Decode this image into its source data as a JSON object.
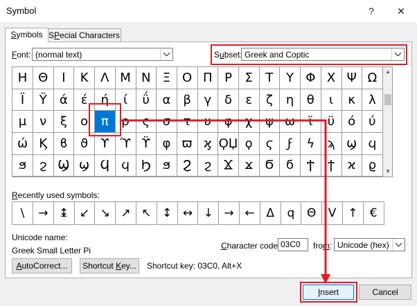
{
  "window": {
    "title": "Symbol",
    "help_glyph": "?",
    "close_glyph": "✕"
  },
  "tabs": [
    {
      "label_key": "S",
      "label_rest": "ymbols"
    },
    {
      "label_key": "P",
      "label_pre": "S",
      "label_rest": "ecial Characters"
    }
  ],
  "font": {
    "label_key": "F",
    "label_rest": "ont:",
    "value": "(normal text)"
  },
  "subset": {
    "label_pre": "S",
    "label_key": "u",
    "label_rest": "bset:",
    "value": "Greek and Coptic"
  },
  "grid": {
    "rows": [
      [
        "Η",
        "Θ",
        "Ι",
        "Κ",
        "Λ",
        "Μ",
        "Ν",
        "Ξ",
        "Ο",
        "Π",
        "Ρ",
        "Σ",
        "Τ",
        "Υ",
        "Φ",
        "Χ",
        "Ψ",
        "Ω"
      ],
      [
        "Ϊ",
        "Ϋ",
        "ά",
        "έ",
        "ή",
        "ί",
        "ΰ",
        "α",
        "β",
        "γ",
        "δ",
        "ε",
        "ζ",
        "η",
        "θ",
        "ι",
        "κ",
        "λ"
      ],
      [
        "μ",
        "ν",
        "ξ",
        "ο",
        "π",
        "ρ",
        "ς",
        "σ",
        "τ",
        "υ",
        "φ",
        "χ",
        "ψ",
        "ω",
        "ϊ",
        "ϋ",
        "ό",
        "ύ"
      ],
      [
        "ώ",
        "Ϗ",
        "ϐ",
        "ϑ",
        "ϒ",
        "ϓ",
        "ϔ",
        "φ",
        "ϖ",
        "ϗ",
        "ϘЏ",
        "ϙ",
        "ϛ",
        "ϝ",
        "ϟ",
        "ϡ",
        "ϣ",
        "ϥ"
      ],
      [
        "ϧ",
        "ϩ",
        "Ϣ",
        "ϣ",
        "Ϥ",
        "ϥ",
        "Ϧ",
        "ϧ",
        "Ϩ",
        "ϩ",
        "Ϫ",
        "ϫ",
        "Ϭ",
        "ϭ",
        "Ϯ",
        "ϯ",
        "ϰ",
        "ϱ"
      ]
    ],
    "selected": "π"
  },
  "recent": {
    "label_key": "R",
    "label_rest": "ecently used symbols:",
    "symbols": [
      "\\",
      "→",
      "↨",
      "↙",
      "↘",
      "↗",
      "↖",
      "↕",
      "↔",
      "↓",
      "→",
      "←",
      "Δ",
      "q",
      "Θ",
      "V",
      "↑",
      "€"
    ]
  },
  "unicode_name": {
    "label": "Unicode name:",
    "value": "Greek Small Letter Pi"
  },
  "char_code": {
    "label_pre": "",
    "label_key": "C",
    "label_rest": "haracter code:",
    "value": "03C0"
  },
  "from": {
    "label_pre": "fro",
    "label_key": "m",
    "label_rest": ":",
    "value": "Unicode (hex)"
  },
  "buttons": {
    "autocorrect_key": "A",
    "autocorrect_rest": "utoCorrect...",
    "shortcut_key_pre": "Shortcut ",
    "shortcut_key_key": "K",
    "shortcut_key_rest": "ey...",
    "shortcut_text": "Shortcut key: 03C0, Alt+X",
    "insert_pre": "",
    "insert_key": "I",
    "insert_rest": "nsert",
    "cancel": "Cancel"
  },
  "colors": {
    "annotation_red": "#e01b24",
    "selection_blue": "#0078d7"
  }
}
